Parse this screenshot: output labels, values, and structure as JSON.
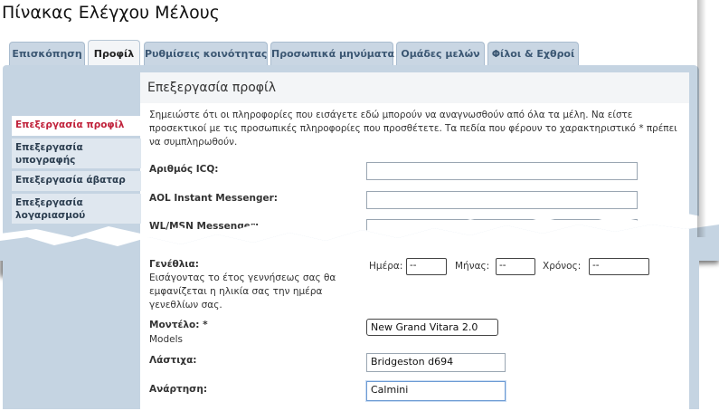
{
  "page": {
    "title": "Πίνακας Ελέγχου Μέλους"
  },
  "tabs": [
    {
      "label": "Επισκόπηση",
      "active": false
    },
    {
      "label": "Προφίλ",
      "active": true
    },
    {
      "label": "Ρυθμίσεις κοινότητας",
      "active": false
    },
    {
      "label": "Προσωπικά μηνύματα",
      "active": false
    },
    {
      "label": "Ομάδες μελών",
      "active": false
    },
    {
      "label": "Φίλοι & Εχθροί",
      "active": false
    }
  ],
  "section": {
    "title": "Επεξεργασία προφίλ"
  },
  "sidebar": {
    "items": [
      {
        "label": "Επεξεργασία προφίλ",
        "active": true
      },
      {
        "label": "Επεξεργασία υπογραφής",
        "active": false
      },
      {
        "label": "Επεξεργασία άβαταρ",
        "active": false
      },
      {
        "label": "Επεξεργασία λογαριασμού",
        "active": false
      }
    ]
  },
  "form": {
    "note": "Σημειώστε ότι οι πληροφορίες που εισάγετε εδώ μπορούν να αναγνωσθούν από όλα τα μέλη. Να είστε προσεκτικοί με τις προσωπικές πληροφορίες που προσθέτετε. Τα πεδία που φέρουν το χαρακτηριστικό * πρέπει να συμπληρωθούν.",
    "icq": {
      "label": "Αριθμός ICQ:",
      "value": ""
    },
    "aol": {
      "label": "AOL Instant Messenger:",
      "value": ""
    },
    "msn": {
      "label": "WL/MSN Messenger:",
      "value": ""
    },
    "birthday": {
      "label": "Γενέθλια:",
      "help": "Εισάγοντας το έτος γεννήσεως σας θα εμφανίζεται η ηλικία σας την ημέρα γενεθλίων σας.",
      "day_label": "Ημέρα:",
      "day_value": "--",
      "month_label": "Μήνας:",
      "month_value": "--",
      "year_label": "Χρόνος:",
      "year_value": "--"
    },
    "model": {
      "label": "Μοντέλο: *",
      "sublabel": "Models",
      "value": "New Grand Vitara 2.0"
    },
    "tyres": {
      "label": "Λάστιχα:",
      "value": "Bridgeston d694"
    },
    "suspension": {
      "label": "Ανάρτηση:",
      "value": "Calmini"
    }
  },
  "colors": {
    "panel": "#c5d4e2",
    "tab": "#c9d6e3",
    "active_nav_text": "#c0223b",
    "focus_border": "#6d9bd4"
  }
}
